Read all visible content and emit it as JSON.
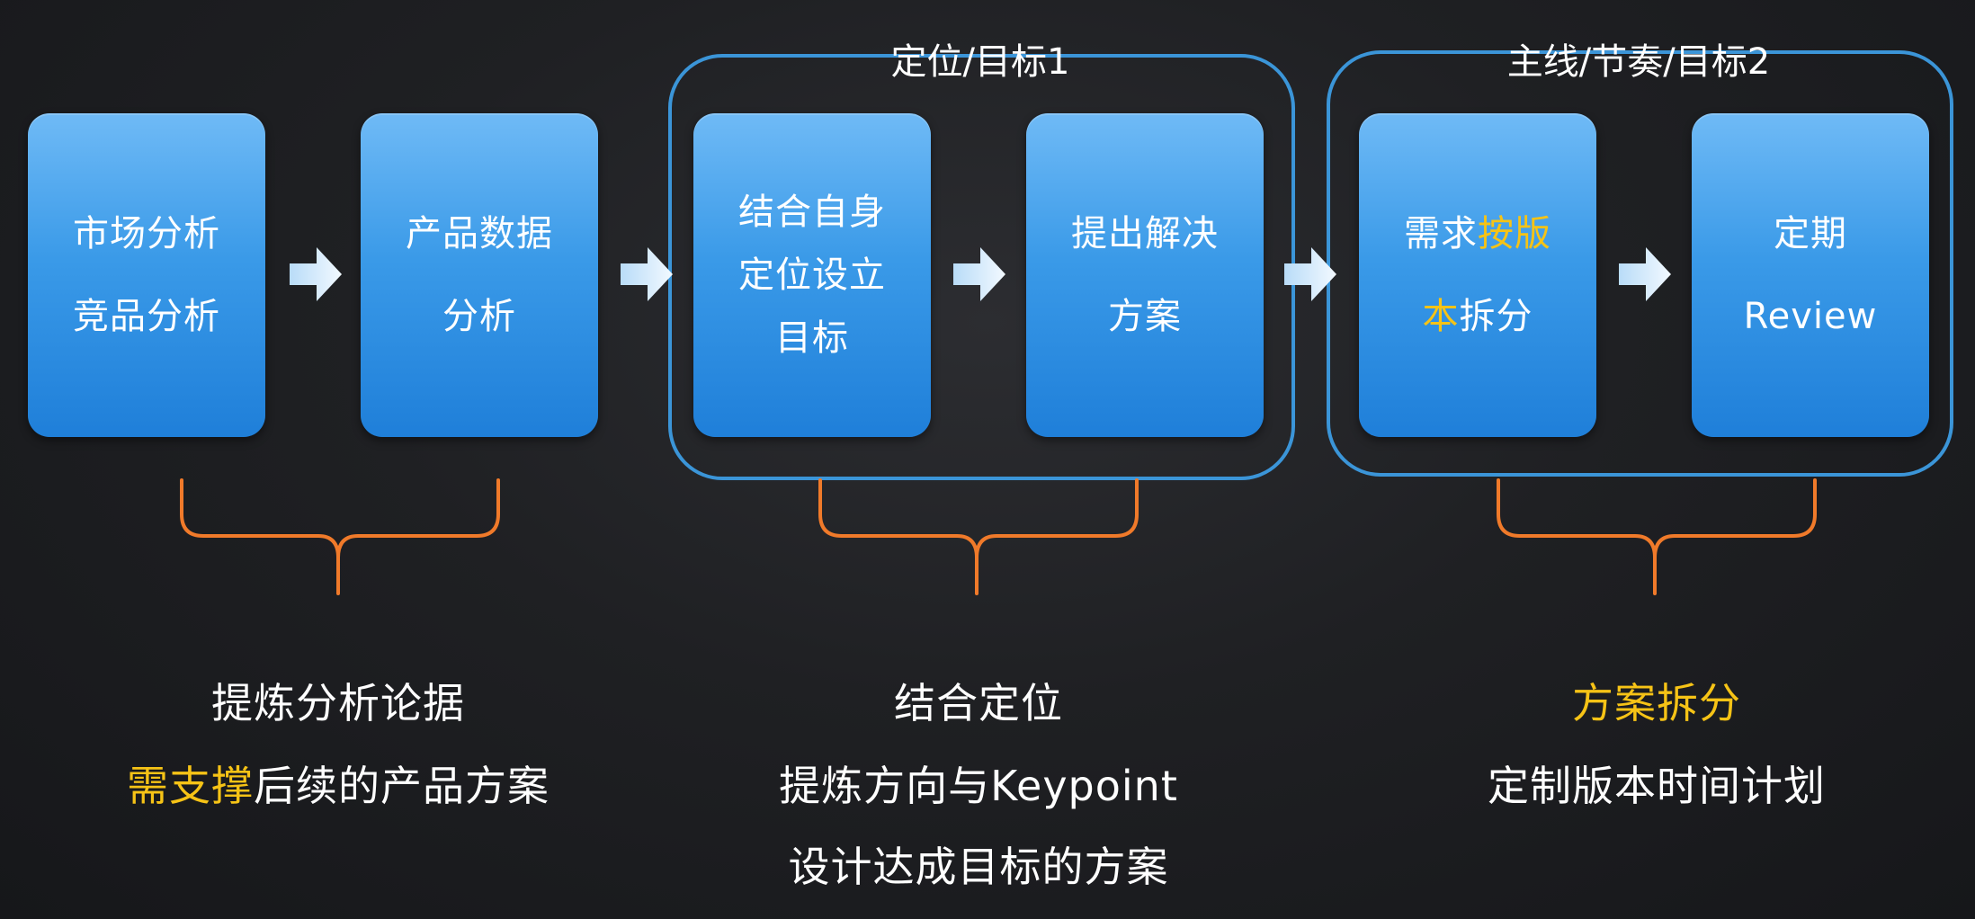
{
  "groups": [
    {
      "id": "group1",
      "title": "定位/目标1"
    },
    {
      "id": "group2",
      "title": "主线/节奏/目标2"
    }
  ],
  "boxes": [
    {
      "id": "market",
      "lines": [
        "市场分析",
        "竞品分析"
      ]
    },
    {
      "id": "data",
      "lines": [
        "产品数据",
        "分析"
      ]
    },
    {
      "id": "target",
      "lines": [
        "结合自身",
        "定位设立",
        "目标"
      ]
    },
    {
      "id": "solution",
      "lines": [
        "提出解决",
        "方案"
      ]
    },
    {
      "id": "split",
      "line1_white": "需求",
      "line1_highlight": "按版",
      "line2_highlight": "本",
      "line2_white": "拆分"
    },
    {
      "id": "review",
      "lines": [
        "定期",
        "Review"
      ]
    }
  ],
  "captions": {
    "left": {
      "line1": "提炼分析论据",
      "line2_highlight": "需支撑",
      "line2_rest": "后续的产品方案"
    },
    "middle": {
      "line1": "结合定位",
      "line2": "提炼方向与Keypoint",
      "line3": "设计达成目标的方案"
    },
    "right": {
      "line1_highlight": "方案拆分",
      "line2": "定制版本时间计划"
    }
  },
  "colors": {
    "box_top": "#6fbaf6",
    "box_bottom": "#1f7fd9",
    "group_border": "#3b95d8",
    "brace": "#f07a2a",
    "highlight": "#f6c316",
    "arrow": "#d8ecfc"
  },
  "icons": [
    "right-arrow-icon",
    "curly-brace-icon"
  ]
}
